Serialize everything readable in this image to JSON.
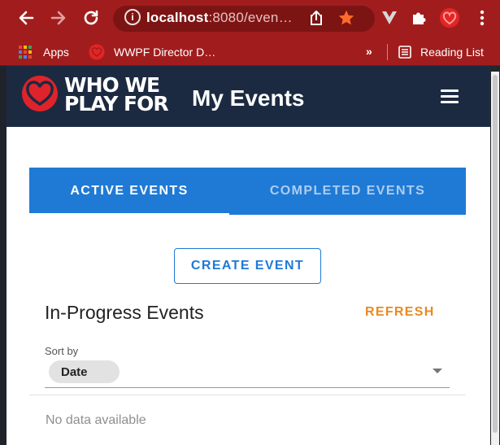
{
  "browser": {
    "url_host": "localhost",
    "url_rest": ":8080/even…",
    "bookmarks": {
      "apps_label": "Apps",
      "wwpf_label": "WWPF Director D…",
      "overflow_label": "»",
      "reading_list_label": "Reading List"
    },
    "colors": {
      "frame": "#a11d1d",
      "omnibox": "#7d1414"
    }
  },
  "app": {
    "logo_line1": "WHO WE",
    "logo_line2": "PLAY FOR",
    "title": "My Events",
    "tabs": [
      {
        "label": "ACTIVE EVENTS",
        "active": true
      },
      {
        "label": "COMPLETED EVENTS",
        "active": false
      }
    ],
    "create_label": "CREATE EVENT",
    "section_title": "In-Progress Events",
    "refresh_label": "REFRESH",
    "sort": {
      "label": "Sort by",
      "value": "Date"
    },
    "empty_text": "No data available",
    "colors": {
      "navbar": "#1c2a41",
      "accent": "#1f7ad5",
      "refresh": "#e88a23",
      "logo_heart": "#e0232b"
    }
  }
}
